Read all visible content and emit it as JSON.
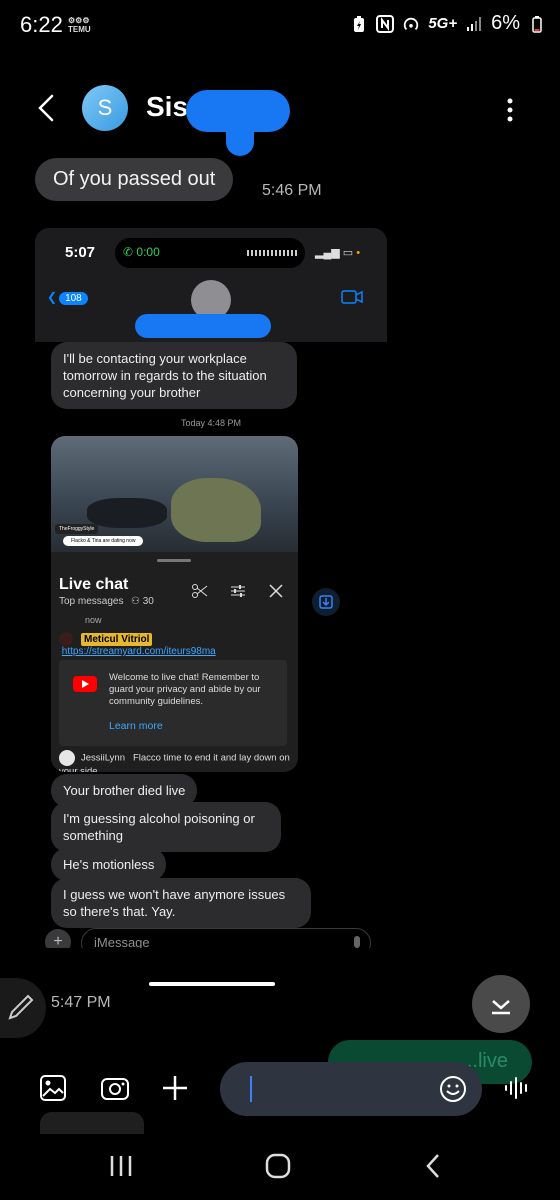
{
  "status_bar": {
    "time": "6:22",
    "notif_line1": "⚙⚙⚙",
    "notif_line2": "TEMU",
    "network": "5G+",
    "battery": "6%"
  },
  "header": {
    "avatar_letter": "S",
    "contact_name": "Sis"
  },
  "messages": {
    "incoming_1": "Of you passed out",
    "incoming_1_time": "5:46 PM",
    "time_2": "5:47 PM",
    "outgoing_partial": "...live"
  },
  "screenshot": {
    "time": "5:07",
    "call_duration": "0:00",
    "back_count": "108",
    "bubble_1": "I'll be contacting your workplace tomorrow in regards to the situation concerning your brother",
    "today_label": "Today 4:48 PM",
    "video": {
      "streamer": "TheFroggyStyle",
      "caption": "Flacko & Tina are dating now"
    },
    "live_chat": {
      "title": "Live chat",
      "subtitle": "Top messages",
      "viewers": "30",
      "now_text": "now",
      "user1": "Meticul Vitriol",
      "link1": "https://streamyard.com/iteurs98ma",
      "welcome": "Welcome to live chat! Remember to guard your privacy and abide by our community guidelines.",
      "learn_more": "Learn more",
      "user2": "JessiiLynn",
      "msg2": "Flacco time to end it and lay down on your side."
    },
    "bubble_2": "Your brother died live",
    "bubble_3": "I'm guessing alcohol poisoning or something",
    "bubble_4": "He's motionless",
    "bubble_5": "I guess we won't have anymore issues so there's that. Yay.",
    "input_placeholder": "iMessage"
  },
  "icons": [
    "back-arrow-icon",
    "more-vertical-icon",
    "edit-pencil-icon",
    "scroll-down-icon",
    "gallery-icon",
    "camera-icon",
    "plus-icon",
    "emoji-icon",
    "voice-icon",
    "recents-nav-icon",
    "home-nav-icon",
    "back-nav-icon"
  ],
  "colors": {
    "background": "#000000",
    "bubble_in": "#3a3a3c",
    "accent_blue": "#0a84ff",
    "redaction": "#1877f2"
  }
}
